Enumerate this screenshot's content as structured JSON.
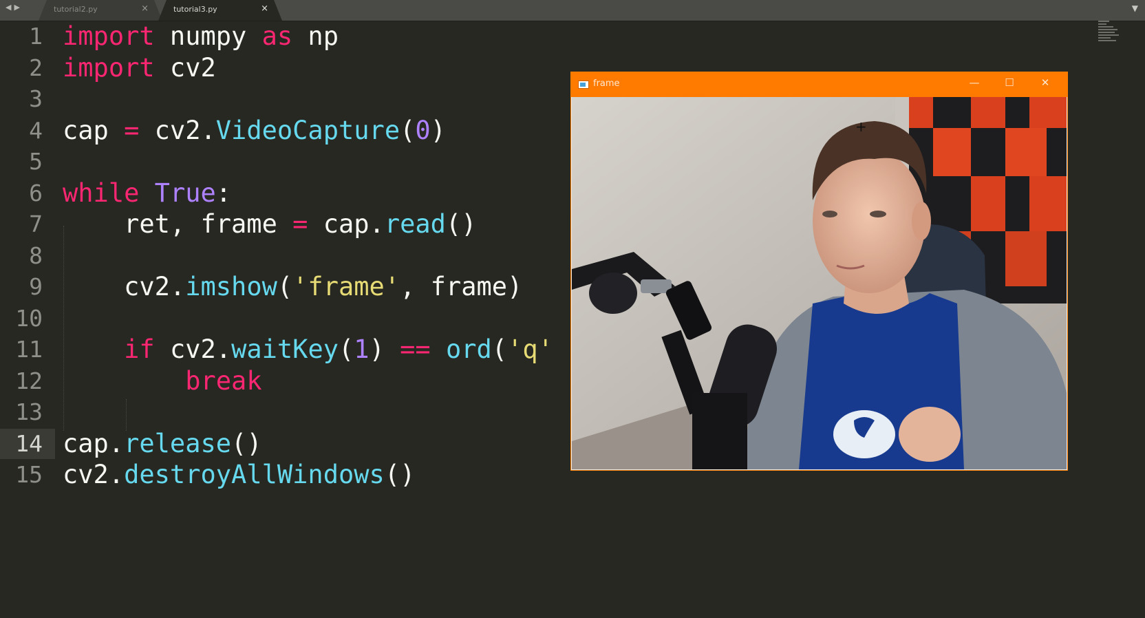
{
  "tabs": [
    {
      "label": "tutorial2.py",
      "close": "×",
      "active": false
    },
    {
      "label": "tutorial3.py",
      "close": "×",
      "active": true
    }
  ],
  "nav": {
    "back": "◀",
    "forward": "▶",
    "overflow": "▼"
  },
  "editor": {
    "current_line": 14,
    "lines": [
      {
        "num": "1",
        "segments": [
          [
            "kw",
            "import"
          ],
          [
            "pl",
            " numpy "
          ],
          [
            "kw",
            "as"
          ],
          [
            "pl",
            " np"
          ]
        ]
      },
      {
        "num": "2",
        "segments": [
          [
            "kw",
            "import"
          ],
          [
            "pl",
            " cv2"
          ]
        ]
      },
      {
        "num": "3",
        "segments": []
      },
      {
        "num": "4",
        "segments": [
          [
            "pl",
            "cap "
          ],
          [
            "op",
            "="
          ],
          [
            "pl",
            " cv2."
          ],
          [
            "fn",
            "VideoCapture"
          ],
          [
            "pl",
            "("
          ],
          [
            "num",
            "0"
          ],
          [
            "pl",
            ")"
          ]
        ]
      },
      {
        "num": "5",
        "segments": []
      },
      {
        "num": "6",
        "segments": [
          [
            "kw",
            "while"
          ],
          [
            "pl",
            " "
          ],
          [
            "const",
            "True"
          ],
          [
            "pl",
            ":"
          ]
        ]
      },
      {
        "num": "7",
        "segments": [
          [
            "pl",
            "    ret, frame "
          ],
          [
            "op",
            "="
          ],
          [
            "pl",
            " cap."
          ],
          [
            "fn",
            "read"
          ],
          [
            "pl",
            "()"
          ]
        ]
      },
      {
        "num": "8",
        "segments": []
      },
      {
        "num": "9",
        "segments": [
          [
            "pl",
            "    cv2."
          ],
          [
            "fn",
            "imshow"
          ],
          [
            "pl",
            "("
          ],
          [
            "str",
            "'frame'"
          ],
          [
            "pl",
            ", frame)"
          ]
        ]
      },
      {
        "num": "10",
        "segments": []
      },
      {
        "num": "11",
        "segments": [
          [
            "pl",
            "    "
          ],
          [
            "kw",
            "if"
          ],
          [
            "pl",
            " cv2."
          ],
          [
            "fn",
            "waitKey"
          ],
          [
            "pl",
            "("
          ],
          [
            "num",
            "1"
          ],
          [
            "pl",
            ") "
          ],
          [
            "op",
            "=="
          ],
          [
            "pl",
            " "
          ],
          [
            "fn",
            "ord"
          ],
          [
            "pl",
            "("
          ],
          [
            "str",
            "'q'"
          ]
        ]
      },
      {
        "num": "12",
        "segments": [
          [
            "pl",
            "        "
          ],
          [
            "kw",
            "break"
          ]
        ]
      },
      {
        "num": "13",
        "segments": []
      },
      {
        "num": "14",
        "segments": [
          [
            "pl",
            "cap."
          ],
          [
            "fn",
            "release"
          ],
          [
            "pl",
            "()"
          ]
        ]
      },
      {
        "num": "15",
        "segments": [
          [
            "pl",
            "cv2."
          ],
          [
            "fn",
            "destroyAllWindows"
          ],
          [
            "pl",
            "()"
          ]
        ]
      }
    ]
  },
  "camera_window": {
    "title": "frame",
    "minimize": "—",
    "maximize": "☐",
    "close": "✕"
  },
  "colors": {
    "background": "#272822",
    "keyword": "#f92672",
    "function": "#66d9ef",
    "number": "#ae81ff",
    "string": "#e6db74",
    "window_titlebar": "#ff7b00"
  }
}
